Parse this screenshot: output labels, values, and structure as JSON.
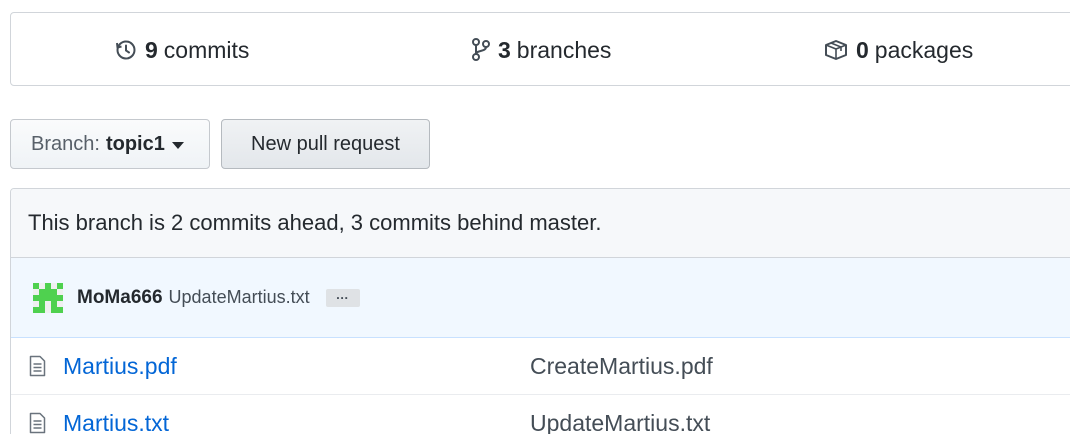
{
  "summary": {
    "commits": {
      "count": "9",
      "label": "commits",
      "icon": "history-icon"
    },
    "branches": {
      "count": "3",
      "label": "branches",
      "icon": "git-branch-icon"
    },
    "packages": {
      "count": "0",
      "label": "packages",
      "icon": "package-icon"
    }
  },
  "actions": {
    "branch_prefix": "Branch:",
    "branch_name": "topic1",
    "new_pull_request": "New pull request"
  },
  "branch_info": {
    "text": "This branch is 2 commits ahead, 3 commits behind master."
  },
  "latest_commit": {
    "author": "MoMa666",
    "message": "UpdateMartius.txt",
    "ellipsis": "…",
    "avatar_color": "#4fd14f"
  },
  "files": [
    {
      "name": "Martius.pdf",
      "commit_message": "CreateMartius.pdf",
      "icon": "file-icon"
    },
    {
      "name": "Martius.txt",
      "commit_message": "UpdateMartius.txt",
      "icon": "file-icon"
    }
  ],
  "colors": {
    "link": "#0366d6",
    "border": "#d1d5da",
    "commit_tease_bg": "#f1f8ff",
    "branch_info_bg": "#f6f8fa"
  }
}
